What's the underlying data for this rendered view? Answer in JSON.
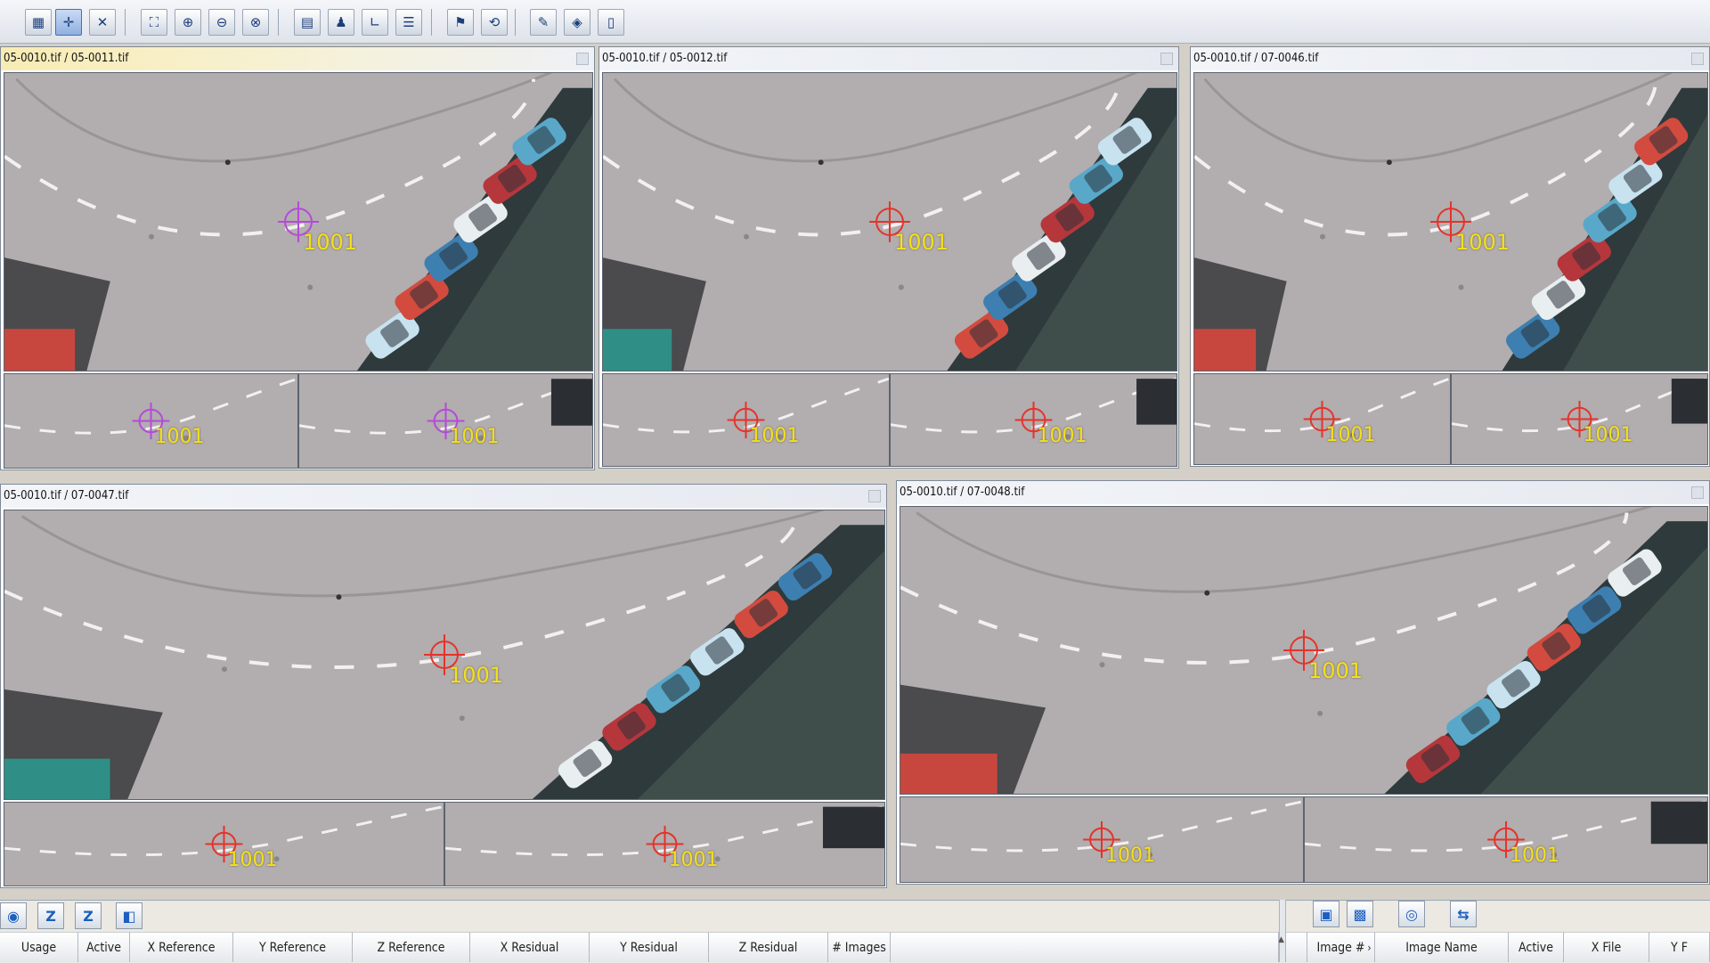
{
  "toolbar": {
    "buttons": [
      {
        "icon": "palette-icon",
        "glyph": "▦"
      },
      {
        "icon": "measure-point-icon",
        "glyph": "✛"
      },
      {
        "icon": "crosshair-icon",
        "glyph": "✕"
      },
      {
        "icon": "fit-window-icon",
        "glyph": "⛶"
      },
      {
        "icon": "zoom-in-icon",
        "glyph": "⊕"
      },
      {
        "icon": "zoom-out-icon",
        "glyph": "⊖"
      },
      {
        "icon": "zoom-reset-icon",
        "glyph": "⊗"
      },
      {
        "icon": "grid-layout-icon",
        "glyph": "▤"
      },
      {
        "icon": "person-icon",
        "glyph": "♟"
      },
      {
        "icon": "corner-icon",
        "glyph": "∟"
      },
      {
        "icon": "list-icon",
        "glyph": "☰"
      },
      {
        "icon": "flag-icon",
        "glyph": "⚑"
      },
      {
        "icon": "sync-icon",
        "glyph": "⟲"
      },
      {
        "icon": "pencil-icon",
        "glyph": "✎"
      },
      {
        "icon": "map-icon",
        "glyph": "◈"
      },
      {
        "icon": "document-icon",
        "glyph": "▯"
      }
    ]
  },
  "panels": [
    {
      "title": "05-0010.tif  /  05-0011.tif",
      "point": "1001",
      "active": true
    },
    {
      "title": "05-0010.tif  /  05-0012.tif",
      "point": "1001",
      "active": false
    },
    {
      "title": "05-0010.tif  /  07-0046.tif",
      "point": "1001",
      "active": false
    },
    {
      "title": "05-0010.tif  /  07-0047.tif",
      "point": "1001",
      "active": false
    },
    {
      "title": "05-0010.tif  /  07-0048.tif",
      "point": "1001",
      "active": false
    }
  ],
  "bottom": {
    "left_buttons": [
      {
        "icon": "globe-icon",
        "glyph": "◉"
      },
      {
        "icon": "z-icon",
        "glyph": "Z"
      },
      {
        "icon": "z-sub-icon",
        "glyph": "Z"
      },
      {
        "icon": "camera-icon",
        "glyph": "◧"
      }
    ],
    "right_buttons": [
      {
        "icon": "image-list-icon",
        "glyph": "▣"
      },
      {
        "icon": "image-select-icon",
        "glyph": "▩"
      },
      {
        "icon": "search-image-icon",
        "glyph": "◎"
      },
      {
        "icon": "sync-image-icon",
        "glyph": "⇆"
      }
    ],
    "left_columns": [
      "Usage",
      "Active",
      "X Reference",
      "Y Reference",
      "Z Reference",
      "X Residual",
      "Y Residual",
      "Z Residual",
      "# Images"
    ],
    "right_columns": [
      "Image #",
      "Image Name",
      "Active",
      "X File",
      "Y F"
    ],
    "sort_glyph": "▲",
    "scroll_glyph": "›"
  },
  "colors": {
    "crosshair_active": "#b34bd8",
    "crosshair": "#e4332b",
    "label": "#f3e01c",
    "road": "#b2adae"
  }
}
